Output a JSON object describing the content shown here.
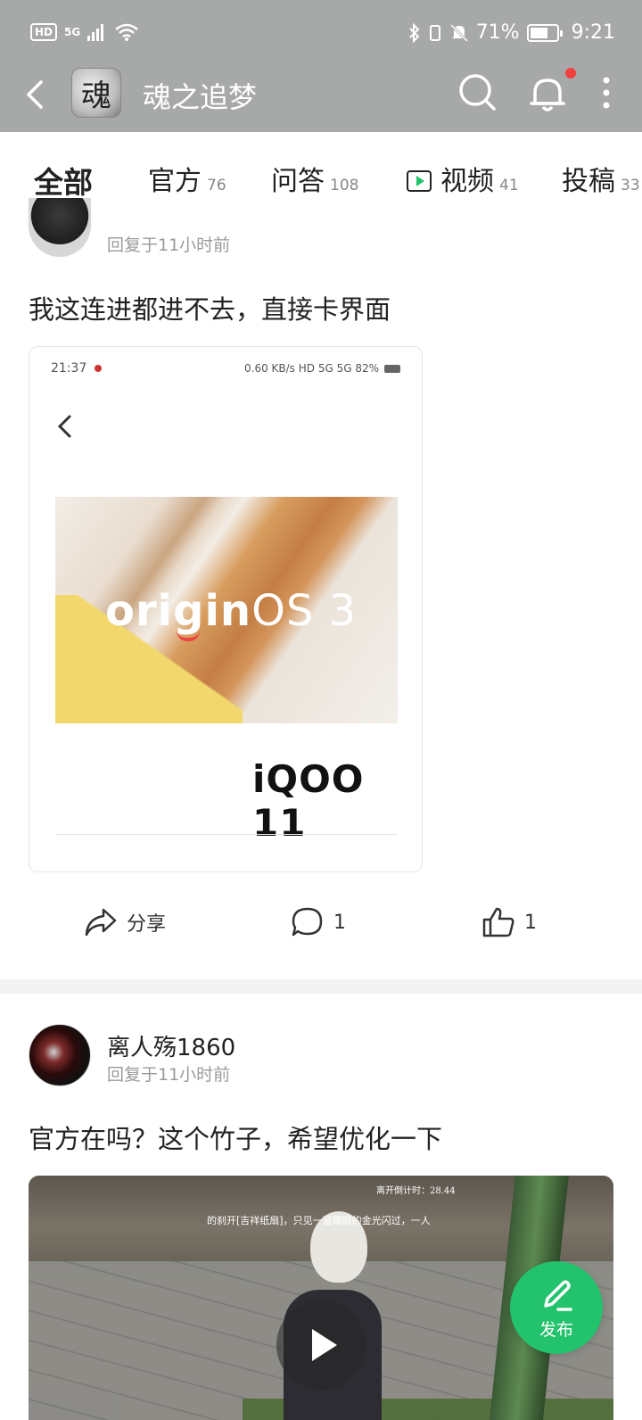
{
  "status_bar": {
    "hd": "HD",
    "network": "5G",
    "battery_pct": "71%",
    "battery_level": 0.71,
    "time": "9:21"
  },
  "header": {
    "title": "魂之追梦",
    "avatar_glyph": "魂"
  },
  "tabs": [
    {
      "label": "全部",
      "count": ""
    },
    {
      "label": "官方",
      "count": "76"
    },
    {
      "label": "问答",
      "count": "108"
    },
    {
      "label": "视频",
      "count": "41"
    },
    {
      "label": "投稿",
      "count": "33"
    }
  ],
  "posts": [
    {
      "reply_time": "回复于11小时前",
      "text": "我这连进都进不去，直接卡界面",
      "image": {
        "status_time": "21:37",
        "status_right": "0.60 KB/s  HD  5G  5G  82%",
        "banner_text_a": "origin",
        "banner_text_b": "OS 3",
        "device": "iQOO 11"
      },
      "actions": {
        "share": "分享",
        "comments": "1",
        "likes": "1"
      }
    },
    {
      "author": "离人殇1860",
      "reply_time": "回复于11小时前",
      "text": "官方在吗？这个竹子，希望优化一下",
      "video": {
        "subtitle": "的刹开[吉祥纸扇]，只见一道耀眼的金光闪过，一人",
        "timer": "离开倒计时：28.44"
      }
    }
  ],
  "fab": {
    "label": "发布"
  },
  "colors": {
    "accent": "#23c26c",
    "header_bg": "#a6a9a8",
    "badge": "#f0413f"
  }
}
